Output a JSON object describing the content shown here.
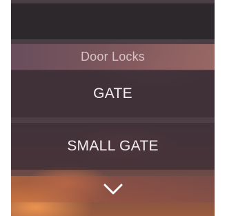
{
  "header": {
    "title": "Door Locks"
  },
  "locks": [
    {
      "label": "GATE"
    },
    {
      "label": "SMALL GATE"
    }
  ],
  "more_button": {
    "icon": "chevron-down-icon"
  },
  "colors": {
    "top_bar": "#2c282c",
    "item_text": "#f4eef0",
    "header_text": "#d8c2c6"
  }
}
